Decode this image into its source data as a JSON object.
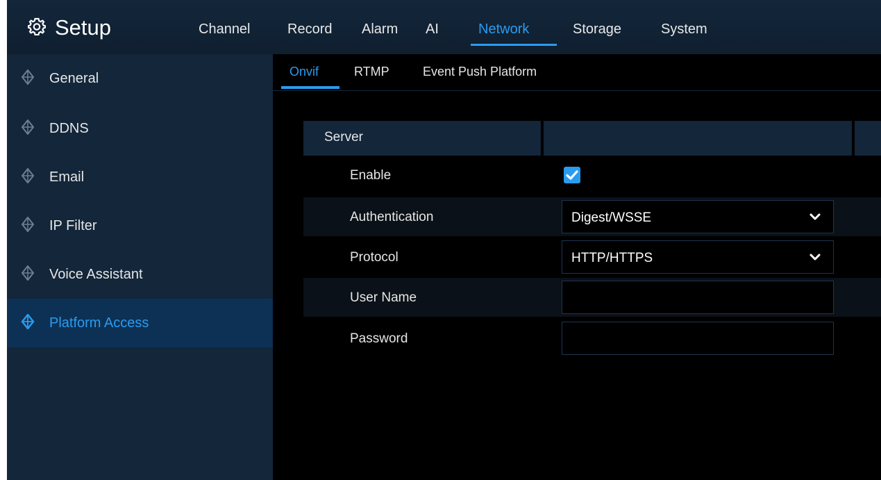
{
  "header": {
    "icon": "gear-icon",
    "title": "Setup",
    "tabs": [
      {
        "label": "Channel"
      },
      {
        "label": "Record"
      },
      {
        "label": "Alarm"
      },
      {
        "label": "AI"
      },
      {
        "label": "Network"
      },
      {
        "label": "Storage"
      },
      {
        "label": "System"
      }
    ],
    "active_tab": "Network"
  },
  "sidebar": {
    "items": [
      {
        "label": "General",
        "icon": "diamond-icon"
      },
      {
        "label": "DDNS",
        "icon": "diamond-icon"
      },
      {
        "label": "Email",
        "icon": "diamond-icon"
      },
      {
        "label": "IP Filter",
        "icon": "diamond-icon"
      },
      {
        "label": "Voice Assistant",
        "icon": "diamond-icon"
      },
      {
        "label": "Platform Access",
        "icon": "diamond-icon"
      }
    ],
    "active_item": "Platform Access"
  },
  "subtabs": {
    "items": [
      {
        "label": "Onvif"
      },
      {
        "label": "RTMP"
      },
      {
        "label": "Event Push Platform"
      }
    ],
    "active": "Onvif"
  },
  "form": {
    "section_header": "Server",
    "enable": {
      "label": "Enable",
      "checked": true
    },
    "authentication": {
      "label": "Authentication",
      "value": "Digest/WSSE"
    },
    "protocol": {
      "label": "Protocol",
      "value": "HTTP/HTTPS"
    },
    "user_name": {
      "label": "User Name",
      "value": ""
    },
    "password": {
      "label": "Password",
      "value": ""
    }
  },
  "colors": {
    "accent": "#2b9bf0",
    "panel": "#13263a",
    "active_row": "#0d3154",
    "background": "#000000"
  }
}
